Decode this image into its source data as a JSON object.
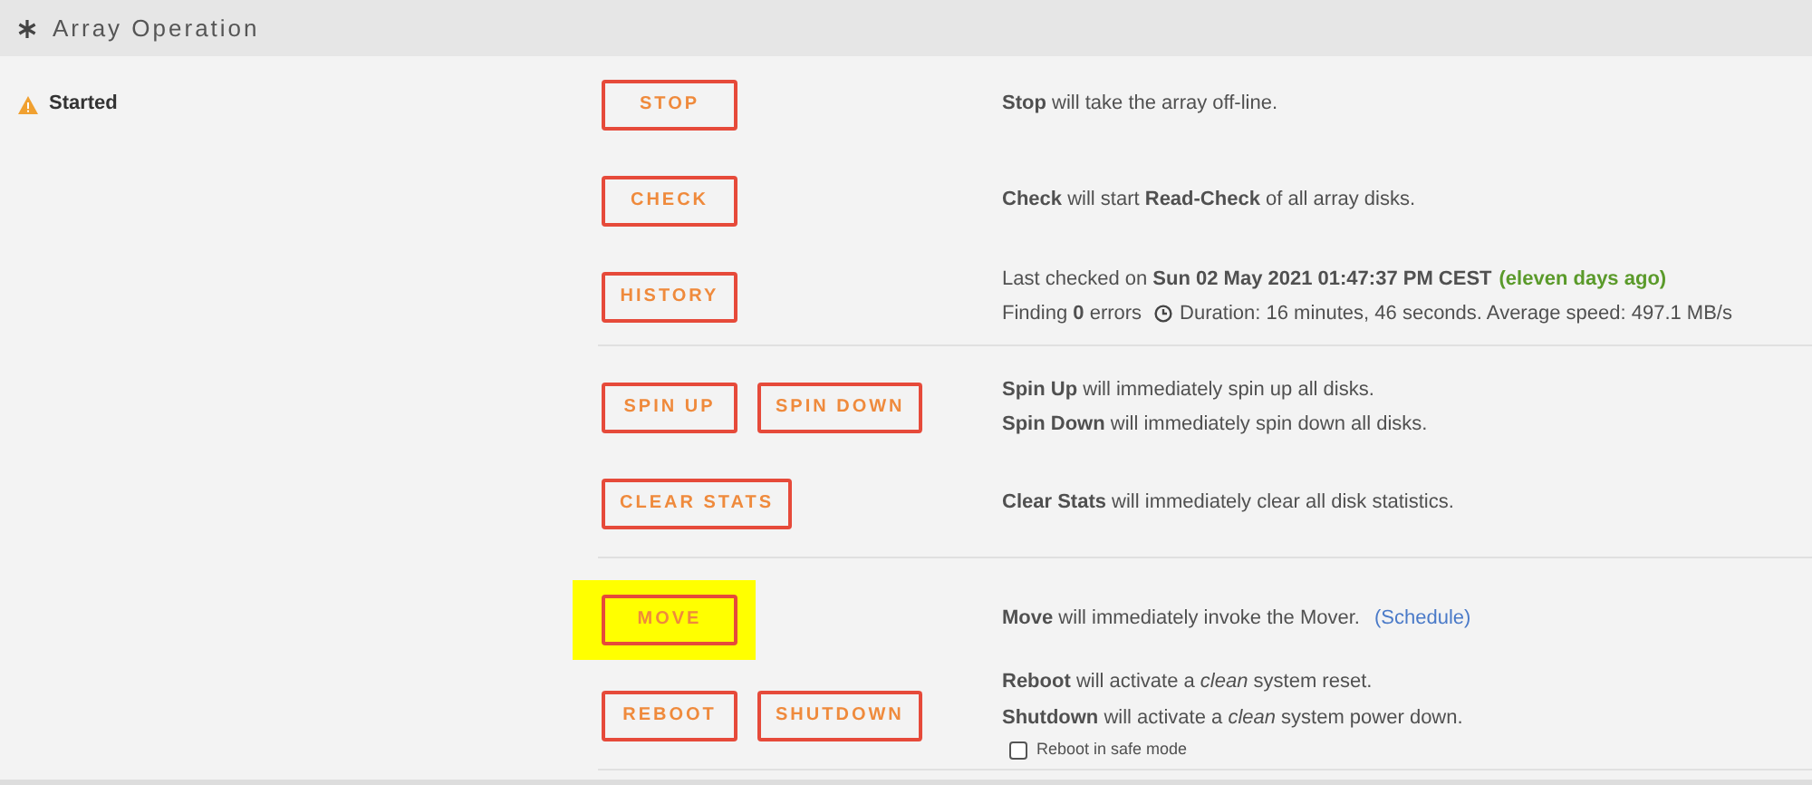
{
  "header": {
    "title": "Array Operation"
  },
  "status": {
    "text": "Started"
  },
  "groups": [
    {
      "rows": [
        {
          "buttons": [
            {
              "label": "STOP",
              "highlighted": false
            }
          ],
          "lines": [
            [
              {
                "kind": "text",
                "text": "**Stop** will take the array off-line."
              }
            ]
          ]
        },
        {
          "buttons": [
            {
              "label": "CHECK",
              "highlighted": false
            }
          ],
          "lines": [
            [
              {
                "kind": "text",
                "text": "**Check** will start **Read-Check** of all array disks."
              }
            ]
          ]
        },
        {
          "buttons": [
            {
              "label": "HISTORY",
              "highlighted": false
            }
          ],
          "lines": [
            [
              {
                "kind": "text",
                "text": "Last checked on **Sun 02 May 2021 01:47:37 PM CEST**"
              },
              {
                "kind": "good",
                "text": "(eleven days ago)"
              }
            ],
            [
              {
                "kind": "text",
                "text": "Finding **0** errors"
              },
              {
                "kind": "clock"
              },
              {
                "kind": "text",
                "text": "Duration: 16 minutes, 46 seconds. Average speed: 497.1 MB/s"
              }
            ]
          ]
        }
      ]
    },
    {
      "rows": [
        {
          "buttons": [
            {
              "label": "SPIN UP",
              "highlighted": false
            },
            {
              "label": "SPIN DOWN",
              "highlighted": false
            }
          ],
          "lines": [
            [
              {
                "kind": "text",
                "text": "**Spin Up** will immediately spin up all disks."
              }
            ],
            [
              {
                "kind": "text",
                "text": "**Spin Down** will immediately spin down all disks."
              }
            ]
          ]
        },
        {
          "buttons": [
            {
              "label": "CLEAR STATS",
              "highlighted": false
            }
          ],
          "lines": [
            [
              {
                "kind": "text",
                "text": "**Clear Stats** will immediately clear all disk statistics."
              }
            ]
          ]
        }
      ]
    },
    {
      "rows": [
        {
          "buttons": [
            {
              "label": "MOVE",
              "highlighted": true
            }
          ],
          "lines": [
            [
              {
                "kind": "text",
                "text": "**Move** will immediately invoke the Mover."
              },
              {
                "kind": "link",
                "text": "(Schedule)"
              }
            ]
          ]
        },
        {
          "buttons": [
            {
              "label": "REBOOT",
              "highlighted": false
            },
            {
              "label": "SHUTDOWN",
              "highlighted": false
            }
          ],
          "lines": [
            [
              {
                "kind": "text",
                "text": "**Reboot** will activate a *clean* system reset."
              }
            ],
            [
              {
                "kind": "text",
                "text": "**Shutdown** will activate a *clean* system power down."
              }
            ]
          ],
          "checkbox": {
            "label": "Reboot in safe mode",
            "checked": false
          }
        }
      ]
    }
  ]
}
